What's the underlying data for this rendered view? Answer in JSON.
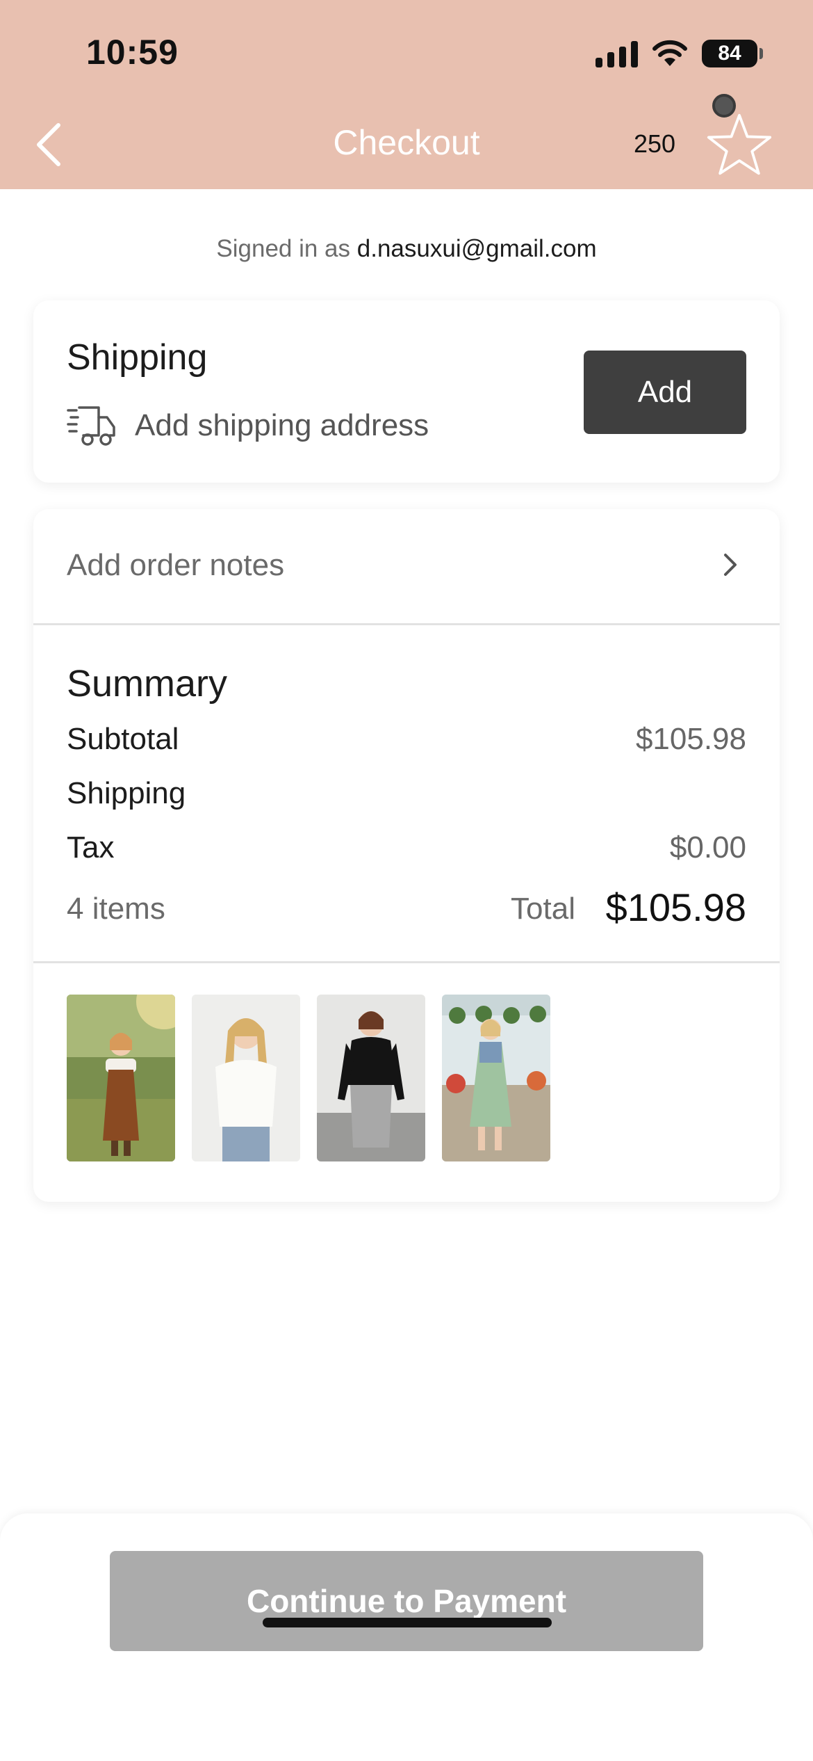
{
  "status_bar": {
    "time": "10:59",
    "battery": "84"
  },
  "nav": {
    "title": "Checkout",
    "points": "250"
  },
  "account": {
    "signed_in_label": "Signed in as",
    "email": "d.nasuxui@gmail.com"
  },
  "shipping": {
    "title": "Shipping",
    "subtitle": "Add shipping address",
    "add_label": "Add"
  },
  "order_notes": {
    "label": "Add order notes"
  },
  "summary": {
    "title": "Summary",
    "subtotal_label": "Subtotal",
    "subtotal_value": "$105.98",
    "shipping_label": "Shipping",
    "tax_label": "Tax",
    "tax_value": "$0.00",
    "items_label": "4 items",
    "total_label": "Total",
    "total_value": "$105.98"
  },
  "products": [
    {
      "name": "girl-brown-overall-dress-thumbnail"
    },
    {
      "name": "white-tee-jeans-thumbnail"
    },
    {
      "name": "black-top-gray-skirt-thumbnail"
    },
    {
      "name": "green-floral-dress-thumbnail"
    }
  ],
  "footer": {
    "continue_label": "Continue to Payment"
  },
  "colors": {
    "header": "#e8c0b0",
    "add_button": "#3f3f3f",
    "pay_button_disabled": "#ababab"
  }
}
